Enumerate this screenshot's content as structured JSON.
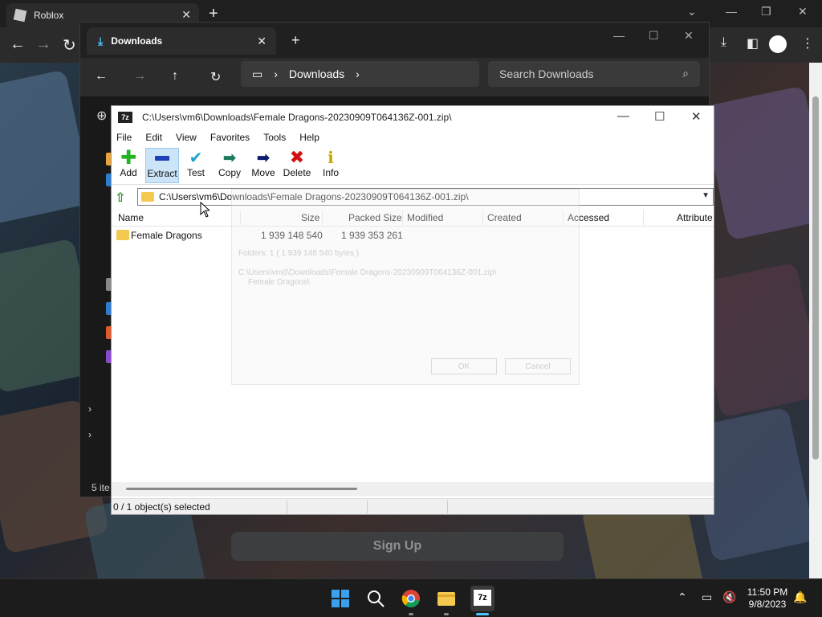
{
  "browser": {
    "tab_title": "Roblox",
    "tab_close": "✕",
    "new_tab": "+",
    "signup_label": "Sign Up"
  },
  "explorer": {
    "tab_title": "Downloads",
    "address_root_icon": "monitor-icon",
    "breadcrumb": "Downloads",
    "search_placeholder": "Search Downloads",
    "status": "5 ite"
  },
  "zip": {
    "title": "C:\\Users\\vm6\\Downloads\\Female Dragons-20230909T064136Z-001.zip\\",
    "logo": "7z",
    "menu": [
      "File",
      "Edit",
      "View",
      "Favorites",
      "Tools",
      "Help"
    ],
    "toolbar": [
      {
        "label": "Add",
        "icon": "plus-icon",
        "color": "#22b222"
      },
      {
        "label": "Extract",
        "icon": "minus-icon",
        "color": "#1f3fb8"
      },
      {
        "label": "Test",
        "icon": "checkmark-icon",
        "color": "#1aa3c8"
      },
      {
        "label": "Copy",
        "icon": "copy-arrow-icon",
        "color": "#1f7a5f"
      },
      {
        "label": "Move",
        "icon": "move-arrow-icon",
        "color": "#0b1f6e"
      },
      {
        "label": "Delete",
        "icon": "delete-x-icon",
        "color": "#d01010"
      },
      {
        "label": "Info",
        "icon": "info-icon",
        "color": "#c8a400"
      }
    ],
    "address": "C:\\Users\\vm6\\Downloads\\Female Dragons-20230909T064136Z-001.zip\\",
    "columns": [
      "Name",
      "Size",
      "Packed Size",
      "Modified",
      "Created",
      "Accessed",
      "Attribute"
    ],
    "rows": [
      {
        "name": "Female Dragons",
        "size": "1 939 148 540",
        "packed": "1 939 353 261"
      }
    ],
    "status": "0 / 1 object(s) selected"
  },
  "ghost_dialog": {
    "line1": "Folders: 1    ( 1 939 148 540 bytes )",
    "line2": "C:\\Users\\vm6\\Downloads\\Female Dragons-20230909T064136Z-001.zip\\",
    "line3": "Female Dragons\\",
    "ok": "OK",
    "cancel": "Cancel"
  },
  "taskbar": {
    "time": "11:50 PM",
    "date": "9/8/2023"
  },
  "colors": {
    "accent_blue": "#4cc2ff",
    "folder_yellow": "#f3c94f",
    "selection_blue": "#cce4f7"
  }
}
